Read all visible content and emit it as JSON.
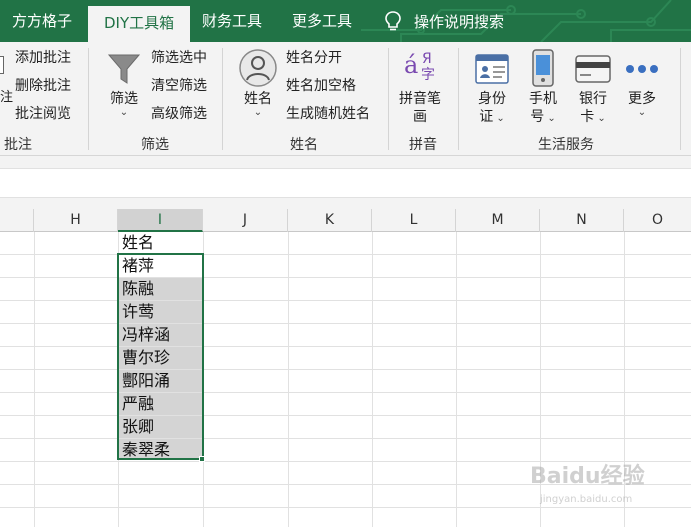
{
  "tabs": [
    {
      "label": "方方格子",
      "active": false
    },
    {
      "label": "DIY工具箱",
      "active": true
    },
    {
      "label": "财务工具",
      "active": false
    },
    {
      "label": "更多工具",
      "active": false
    }
  ],
  "search_tab": {
    "label": "操作说明搜索",
    "icon": "lightbulb-icon"
  },
  "ribbon": {
    "comment_group": {
      "label": "批注",
      "items": [
        "添加批注",
        "删除批注",
        "批注阅览"
      ],
      "edge_glyph": "注"
    },
    "filter_group": {
      "label": "筛选",
      "big_button": {
        "label": "筛选",
        "icon": "funnel-icon"
      },
      "items": [
        "筛选选中",
        "清空筛选",
        "高级筛选"
      ]
    },
    "name_group": {
      "label": "姓名",
      "big_button": {
        "label": "姓名",
        "icon": "person-icon"
      },
      "items": [
        "姓名分开",
        "姓名加空格",
        "生成随机姓名"
      ]
    },
    "pinyin_group": {
      "label": "拼音",
      "big_button": {
        "line1": "拼音笔",
        "line2": "画",
        "icon": "pinyin-icon",
        "icon_letter": "á",
        "icon_letter2": "Я",
        "icon_char": "字"
      }
    },
    "life_group": {
      "label": "生活服务",
      "buttons": [
        {
          "line1": "身份",
          "line2": "证",
          "icon": "id-card-icon"
        },
        {
          "line1": "手机",
          "line2": "号",
          "icon": "mobile-phone-icon"
        },
        {
          "line1": "银行",
          "line2": "卡",
          "icon": "bank-card-icon"
        },
        {
          "line1": "更多",
          "line2": "",
          "icon": "more-dots-icon"
        }
      ]
    }
  },
  "columns": [
    "H",
    "I",
    "J",
    "K",
    "L",
    "M",
    "N",
    "O"
  ],
  "selected_column": "I",
  "cells": [
    "姓名",
    "褚萍",
    "陈融",
    "许莺",
    "冯梓涵",
    "曹尔珍",
    "酆阳涌",
    "严融",
    "张卿",
    "秦翠柔"
  ],
  "colors": {
    "excel_green": "#217346",
    "ribbon_bg": "#f3f3f3",
    "selection_gray": "#d4d4d4"
  },
  "watermark": {
    "main": "Baidu经验",
    "sub": "jingyan.baidu.com"
  }
}
